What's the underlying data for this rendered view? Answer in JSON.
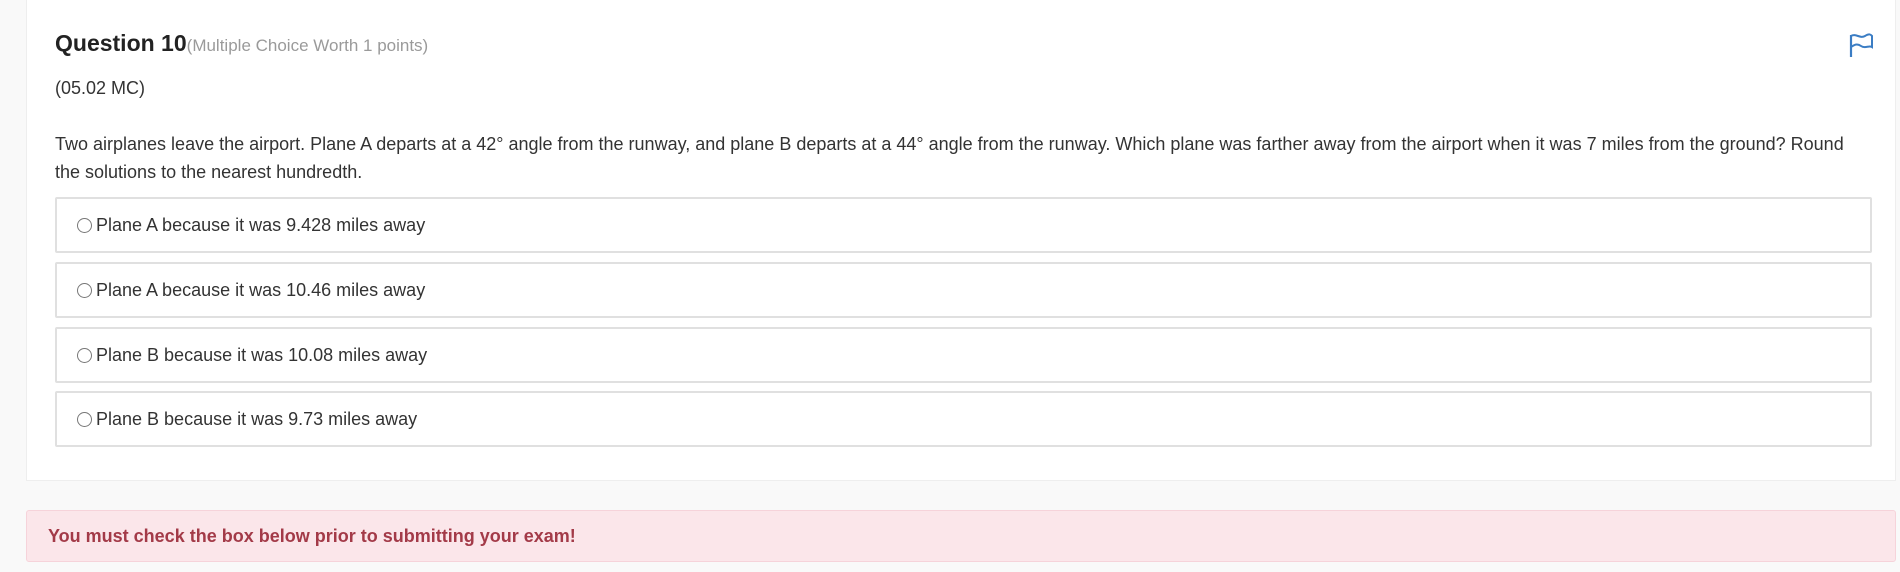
{
  "question": {
    "title": "Question 10",
    "meta": "(Multiple Choice Worth 1 points)",
    "code": "(05.02 MC)",
    "text": "Two airplanes leave the airport. Plane A departs at a 42° angle from the runway, and plane B departs at a 44° angle from the runway. Which plane was farther away from the airport when it was 7 miles from the ground? Round the solutions to the nearest hundredth."
  },
  "choices": [
    {
      "label": "Plane A because it was 9.428 miles away"
    },
    {
      "label": "Plane A because it was 10.46 miles away"
    },
    {
      "label": "Plane B because it was 10.08 miles away"
    },
    {
      "label": "Plane B because it was 9.73 miles away"
    }
  ],
  "alert": {
    "text": "You must check the box below prior to submitting your exam!"
  },
  "colors": {
    "flag": "#3b7dc4",
    "alert_bg": "#fbe6ea",
    "alert_text": "#a33a48"
  },
  "icons": {
    "flag": "flag-icon",
    "radio": "radio-unselected"
  }
}
